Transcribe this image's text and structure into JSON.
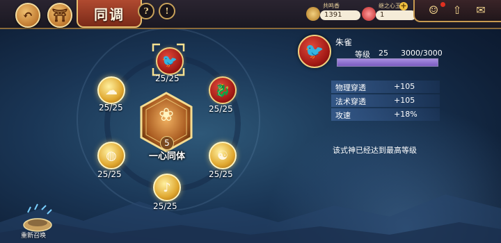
{
  "header": {
    "title": "同调",
    "help_label": "?",
    "alert_label": "!",
    "back_icon": "back-arrow-icon",
    "home_icon": "shrine-icon"
  },
  "resources": [
    {
      "label": "共鸣香",
      "value": "1391",
      "icon": "incense-icon"
    },
    {
      "label": "继之心玉",
      "value": "1",
      "icon": "heart-jade-icon"
    }
  ],
  "right_icons": [
    "chibi-avatar-icon",
    "upgrade-arrow-icon",
    "mail-icon"
  ],
  "circle_nodes": [
    {
      "id": "top",
      "progress": "25/25",
      "style": "red",
      "icon": "crane-icon",
      "selected": true
    },
    {
      "id": "upper-right",
      "progress": "25/25",
      "style": "red",
      "icon": "dragon-icon"
    },
    {
      "id": "lower-right",
      "progress": "25/25",
      "style": "gold",
      "icon": "bagua-icon"
    },
    {
      "id": "bottom",
      "progress": "25/25",
      "style": "gold",
      "icon": "dancer-icon"
    },
    {
      "id": "lower-left",
      "progress": "25/25",
      "style": "gold",
      "icon": "drum-icon"
    },
    {
      "id": "upper-left",
      "progress": "25/25",
      "style": "gold",
      "icon": "cloud-icon"
    }
  ],
  "center": {
    "level": "5",
    "title": "一心同体",
    "icon": "lotus-flame-icon"
  },
  "panel": {
    "name": "朱雀",
    "level_label": "等级",
    "level_value": "25",
    "exp": "3000/3000",
    "exp_fraction": 1.0,
    "stats": [
      {
        "name": "物理穿透",
        "value": "+105"
      },
      {
        "name": "法术穿透",
        "value": "+105"
      },
      {
        "name": "攻速",
        "value": "+18%"
      }
    ],
    "max_note": "该式神已经达到最高等级"
  },
  "resummon_label": "重新召唤",
  "colors": {
    "accent_red": "#a01814",
    "accent_gold": "#e0a830",
    "exp_bar": "#7a5cc0"
  }
}
